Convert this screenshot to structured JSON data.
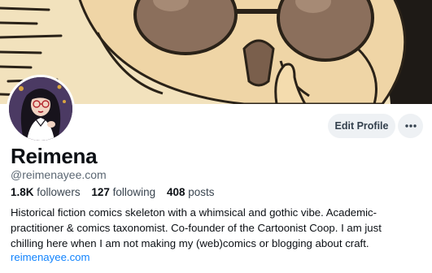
{
  "profile": {
    "display_name": "Reimena",
    "handle": "@reimenayee.com",
    "stats": {
      "followers_count": "1.8K",
      "followers_label": "followers",
      "following_count": "127",
      "following_label": "following",
      "posts_count": "408",
      "posts_label": "posts"
    },
    "bio_lines": [
      "Historical fiction comics skeleton with a whimsical and gothic vibe. Academic-",
      "practitioner & comics taxonomist. Co-founder of the Cartoonist Coop. I am just",
      "chilling here when I am not making my (web)comics or blogging about craft."
    ],
    "link": "reimenayee.com"
  },
  "actions": {
    "edit_profile_label": "Edit Profile",
    "more_icon": "ellipsis-icon"
  },
  "colors": {
    "link": "#1083fe",
    "muted_text": "#5b6773",
    "button_bg": "#eef1f4"
  }
}
